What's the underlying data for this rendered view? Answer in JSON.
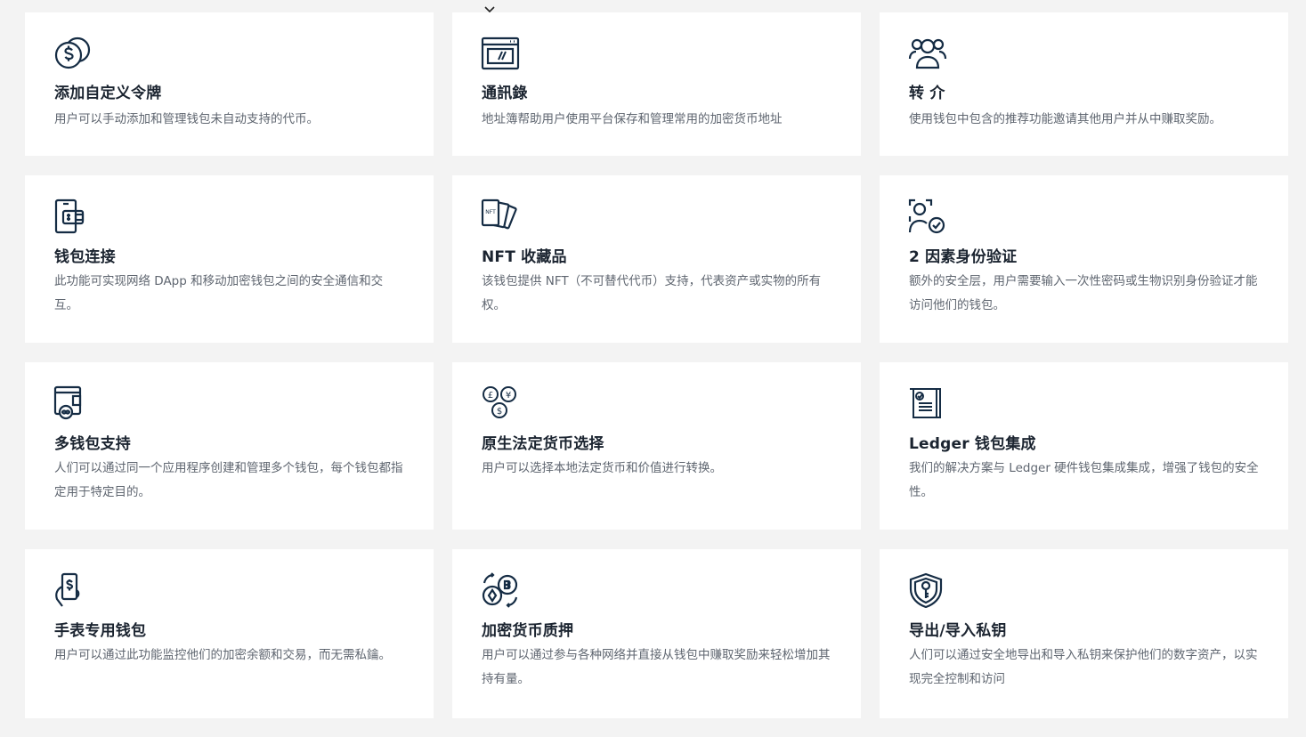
{
  "icon_color": "#152c44",
  "cards": [
    {
      "icon": "coins-dollar-icon",
      "title": "添加自定义令牌",
      "desc": "用户可以手动添加和管理钱包未自动支持的代币。"
    },
    {
      "icon": "address-book-window-icon",
      "title": "通訊錄",
      "desc": "地址簿帮助用户使用平台保存和管理常用的加密货币地址"
    },
    {
      "icon": "users-group-icon",
      "title": "转 介",
      "desc": "使用钱包中包含的推荐功能邀请其他用户并从中赚取奖励。"
    },
    {
      "icon": "phone-wallet-icon",
      "title": "钱包连接",
      "desc": "此功能可实现网络 DApp 和移动加密钱包之间的安全通信和交互。"
    },
    {
      "icon": "nft-cards-icon",
      "title": "NFT 收藏品",
      "desc": "该钱包提供 NFT（不可替代代币）支持，代表资产或实物的所有权。"
    },
    {
      "icon": "user-verified-icon",
      "title": "2 因素身份验证",
      "desc": "额外的安全层，用户需要输入一次性密码或生物识别身份验证才能访问他们的钱包。"
    },
    {
      "icon": "multi-wallet-icon",
      "title": "多钱包支持",
      "desc": "人们可以通过同一个应用程序创建和管理多个钱包，每个钱包都指定用于特定目的。"
    },
    {
      "icon": "fiat-currencies-icon",
      "title": "原生法定货币选择",
      "desc": "用户可以选择本地法定货币和价值进行转换。"
    },
    {
      "icon": "ledger-document-icon",
      "title": "Ledger 钱包集成",
      "desc": "我们的解决方案与 Ledger 硬件钱包集成集成，增强了钱包的安全性。"
    },
    {
      "icon": "watch-wallet-icon",
      "title": "手表专用钱包",
      "desc": "用户可以通过此功能监控他们的加密余额和交易，而无需私鑰。"
    },
    {
      "icon": "crypto-staking-icon",
      "title": "加密货币质押",
      "desc": "用户可以通过参与各种网络并直接从钱包中赚取奖励来轻松增加其持有量。"
    },
    {
      "icon": "shield-key-icon",
      "title": "导出/导入私钥",
      "desc": "人们可以通过安全地导出和导入私钥来保护他们的数字资产，以实现完全控制和访问"
    }
  ]
}
